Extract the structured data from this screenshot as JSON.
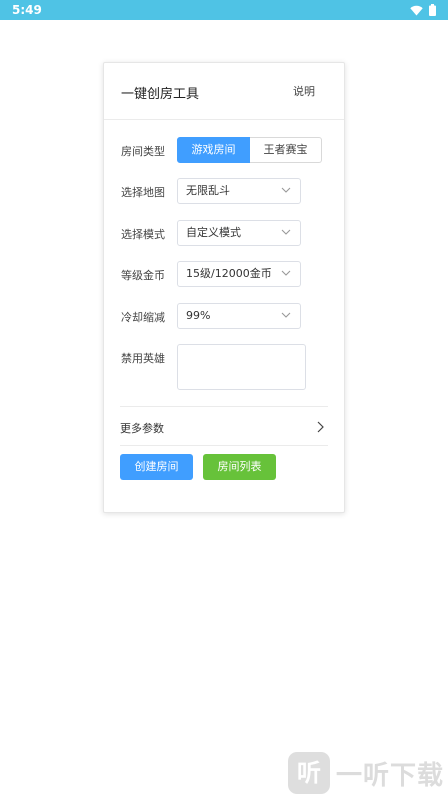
{
  "status_bar": {
    "time": "5:49"
  },
  "card": {
    "title": "一键创房工具",
    "help_link": "说明"
  },
  "form": {
    "room_type": {
      "label": "房间类型",
      "options": [
        "游戏房间",
        "王者赛宝"
      ],
      "selected": "游戏房间"
    },
    "map": {
      "label": "选择地图",
      "value": "无限乱斗"
    },
    "mode": {
      "label": "选择模式",
      "value": "自定义模式"
    },
    "level_gold": {
      "label": "等级金币",
      "value": "15级/12000金币"
    },
    "cooldown": {
      "label": "冷却缩减",
      "value": "99%"
    },
    "ban_heroes": {
      "label": "禁用英雄",
      "value": ""
    },
    "more_params": {
      "label": "更多参数"
    }
  },
  "actions": {
    "create_room": "创建房间",
    "room_list": "房间列表"
  },
  "watermark": {
    "logo_glyph": "听",
    "text": "一听下载"
  },
  "colors": {
    "status_bar": "#4fc3e5",
    "primary": "#409eff",
    "success": "#67c23a"
  }
}
